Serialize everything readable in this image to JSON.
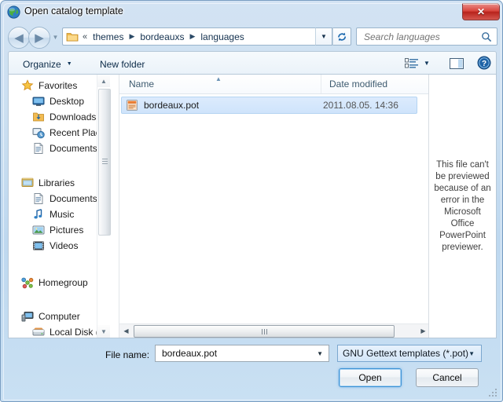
{
  "window": {
    "title": "Open catalog template",
    "icon": "globe-icon",
    "close_label": "✕",
    "accent_blue": "#3e93d6",
    "close_red": "#d9453d"
  },
  "address_bar": {
    "back_arrow": "◀",
    "forward_arrow": "▶",
    "history_caret": "▼",
    "overflow_chevrons": "«",
    "crumbs": [
      "themes",
      "bordeauxs",
      "languages"
    ],
    "crumb_arrow": "▶",
    "dropdown_caret": "▼",
    "refresh_icon": "refresh-icon"
  },
  "search": {
    "placeholder": "Search languages",
    "icon": "search-icon"
  },
  "toolbar": {
    "organize_label": "Organize",
    "organize_caret": "▼",
    "new_folder_label": "New folder",
    "view_mode_icon": "view-mode-icon",
    "view_mode_caret": "▼",
    "preview_pane_icon": "preview-pane-icon",
    "help_icon": "help-icon",
    "help_glyph": "?"
  },
  "nav_pane": {
    "groups": [
      {
        "header": {
          "label": "Favorites",
          "icon": "star-icon"
        },
        "items": [
          {
            "label": "Desktop",
            "icon": "desktop-icon"
          },
          {
            "label": "Downloads",
            "icon": "downloads-icon"
          },
          {
            "label": "Recent Places",
            "icon": "recent-places-icon"
          },
          {
            "label": "Documents",
            "icon": "document-icon"
          }
        ]
      },
      {
        "header": {
          "label": "Libraries",
          "icon": "libraries-icon"
        },
        "items": [
          {
            "label": "Documents",
            "icon": "document-icon"
          },
          {
            "label": "Music",
            "icon": "music-icon"
          },
          {
            "label": "Pictures",
            "icon": "pictures-icon"
          },
          {
            "label": "Videos",
            "icon": "videos-icon"
          }
        ]
      },
      {
        "header": {
          "label": "Homegroup",
          "icon": "homegroup-icon"
        },
        "items": []
      },
      {
        "header": {
          "label": "Computer",
          "icon": "computer-icon"
        },
        "items": [
          {
            "label": "Local Disk (C:",
            "icon": "drive-icon"
          }
        ]
      }
    ],
    "scroll_up": "▲",
    "scroll_down": "▼"
  },
  "file_list": {
    "columns": [
      "Name",
      "Date modified"
    ],
    "sort_indicator": "▲",
    "rows": [
      {
        "name": "bordeaux.pot",
        "date_modified": "2011.08.05. 14:36",
        "icon": "powerpoint-template-icon",
        "selected": true
      }
    ],
    "hscroll_left": "◀",
    "hscroll_right": "▶"
  },
  "preview_pane": {
    "message": "This file can't be previewed because of an error in the Microsoft Office PowerPoint previewer."
  },
  "footer": {
    "filename_label": "File name:",
    "filename_value": "bordeaux.pot",
    "filename_caret": "▼",
    "filetype_value": "GNU Gettext templates (*.pot)",
    "filetype_caret": "▼",
    "open_label": "Open",
    "cancel_label": "Cancel"
  }
}
